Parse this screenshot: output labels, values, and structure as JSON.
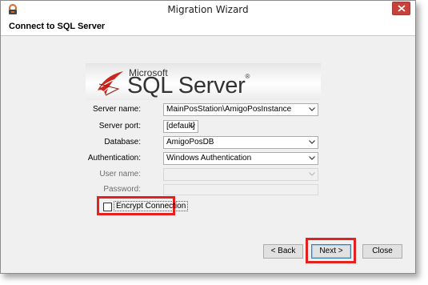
{
  "window": {
    "title": "Migration Wizard",
    "step_title": "Connect to SQL Server"
  },
  "logo": {
    "brand_small": "Microsoft",
    "brand_big": "SQL Server",
    "registered": "®"
  },
  "form": {
    "server_name": {
      "label": "Server name:",
      "value": "MainPosStation\\AmigoPosInstance"
    },
    "server_port": {
      "label": "Server port:",
      "value": "[default]"
    },
    "database": {
      "label": "Database:",
      "value": "AmigoPosDB"
    },
    "authentication": {
      "label": "Authentication:",
      "value": "Windows Authentication"
    },
    "user_name": {
      "label": "User name:",
      "value": ""
    },
    "password": {
      "label": "Password:",
      "value": ""
    },
    "encrypt_connection": {
      "label": "Encrypt Connection",
      "checked": false
    }
  },
  "buttons": {
    "back": "< Back",
    "next": "Next >",
    "close": "Close"
  },
  "colors": {
    "highlight": "#e32121",
    "close_button": "#c7403a",
    "logo_red": "#c8281e"
  }
}
